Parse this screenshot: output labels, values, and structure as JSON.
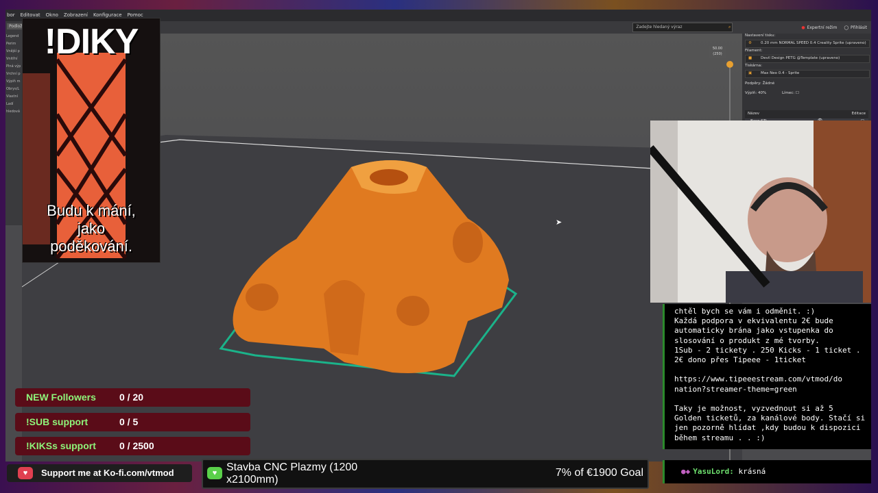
{
  "menu": [
    "bor",
    "Editovat",
    "Okno",
    "Zobrazení",
    "Konfigurace",
    "Pomoc"
  ],
  "toolbar": {
    "tab": "Podlož",
    "search_placeholder": "Zadejte hledaný výraz",
    "expert_mode": "Expertní režim",
    "login": "Přihlásit"
  },
  "left_strip": [
    "Legend",
    "Perim",
    "Vnější p",
    "Vnitřní",
    "Plná výp",
    "Vrchní p",
    "Výplň m",
    "Obrys/L",
    "Vlastní",
    "Ladí",
    "hledová"
  ],
  "right_panel": {
    "print_settings_label": "Nastavení tisku:",
    "print_settings_value": "0.20 mm NORMAL SPEED 0.4 Creality Sprite (upraveno)",
    "filament_label": "Filament:",
    "filament_value": "Devil Design PETG @Template (upraveno)",
    "printer_label": "Tiskárna:",
    "printer_value": "Max Neo 0.4 - Sprite",
    "supports_label": "Podpěry:",
    "supports_value": "Žádné",
    "infill_label": "Výplň:",
    "infill_value": "40%",
    "brim_label": "Límec:",
    "col_name": "Název",
    "col_edit": "Editace",
    "object_name": "Base.STL"
  },
  "layer_slider": {
    "top_value": "50.00",
    "top_layer": "(250)"
  },
  "overlay_diky": {
    "title": "!DIKY",
    "subtitle_lines": [
      "Budu k mání,",
      "jako",
      "poděkování."
    ]
  },
  "chat": {
    "message": "chtěl bych se vám i odměnit. :)\nKaždá podpora v ekvivalentu 2€ bude\nautomaticky brána jako vstupenka do\nslosování o produkt z mé tvorby.\n1Sub - 2 tickety . 250 Kicks - 1 ticket .\n2€ dono přes Tipeee - 1ticket\n\nhttps://www.tipeeestream.com/vtmod/do\nnation?streamer-theme=green\n\nTaky je možnost, vyzvednout si až 5\nGolden ticketů, za kanálové body. Stačí si\njen pozorně hlídat ,kdy budou k dispozici\nběhem streamu . . :)",
    "last_user": "YasuLord:",
    "last_text": "krásná"
  },
  "goals": [
    {
      "label": "NEW Followers",
      "value": "0 / 20"
    },
    {
      "label": "!SUB support",
      "value": "0 / 5"
    },
    {
      "label": "!KIKSs support",
      "value": "0 / 2500"
    }
  ],
  "kofi": {
    "text": "Support me at Ko-fi.com/vtmod"
  },
  "tipee": {
    "title": "Stavba CNC Plazmy (1200 x2100mm)",
    "goal": "7% of €1900 Goal"
  },
  "colors": {
    "model": "#e07a20",
    "goal_bg": "#5a0c18",
    "goal_label": "#8ef57a",
    "chat_border": "#2c8a2c"
  }
}
